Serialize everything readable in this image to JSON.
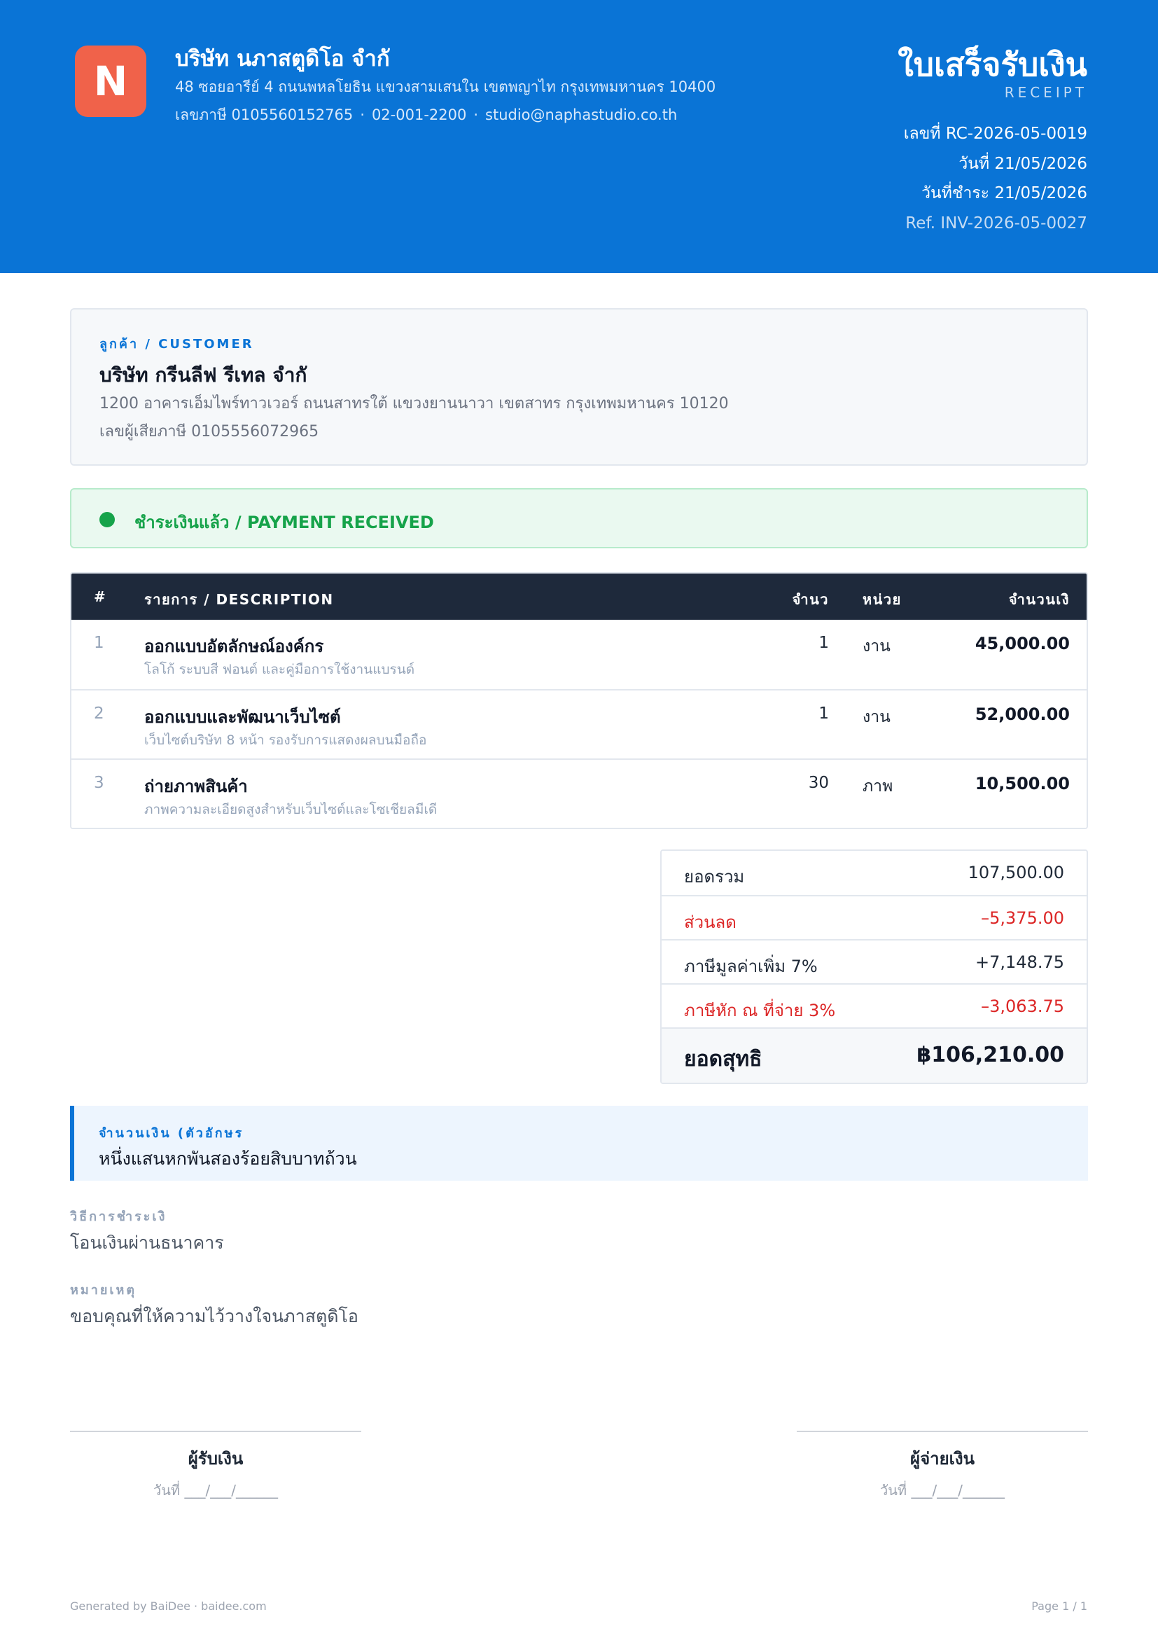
{
  "company": {
    "logo_letter": "N",
    "name": "บริษัท นภาสตูดิโอ จำกั",
    "address": "48 ซอยอารีย์ 4 ถนนพหลโยธิน แขวงสามเสนใน เขตพญาไท กรุงเทพมหานคร 10400",
    "tax_id": "เลขภาษี 0105560152765",
    "phone": "02-001-2200",
    "email": "studio@naphastudio.co.th",
    "separator": "·"
  },
  "document": {
    "title": "ใบเสร็จรับเงิน",
    "subtitle": "RECEIPT",
    "number": "เลขที่ RC-2026-05-0019",
    "date": "วันที่ 21/05/2026",
    "paid_date": "วันที่ชำระ 21/05/2026",
    "reference": "Ref. INV-2026-05-0027"
  },
  "customer": {
    "label": "ลูกค้า / CUSTOMER",
    "name": "บริษัท กรีนลีฟ รีเทล จำกั",
    "address": "1200 อาคารเอ็มไพร์ทาวเวอร์ ถนนสาทรใต้ แขวงยานนาวา เขตสาทร กรุงเทพมหานคร 10120",
    "tax_id": "เลขผู้เสียภาษี 0105556072965"
  },
  "status": {
    "text": "ชำระเงินแล้ว / PAYMENT RECEIVED",
    "color": "#16a34a"
  },
  "items_table": {
    "headers": {
      "num": "#",
      "description": "รายการ / DESCRIPTION",
      "qty": "จำนว",
      "unit": "หน่วย",
      "amount": "จำนวนเงิ"
    },
    "rows": [
      {
        "num": "1",
        "description": "ออกแบบอัตลักษณ์องค์กร",
        "detail": "โลโก้ ระบบสี ฟอนต์ และคู่มือการใช้งานแบรนด์",
        "qty": "1",
        "unit": "งาน",
        "amount": "45,000.00"
      },
      {
        "num": "2",
        "description": "ออกแบบและพัฒนาเว็บไซต์",
        "detail": "เว็บไซต์บริษัท 8 หน้า รองรับการแสดงผลบนมือถือ",
        "qty": "1",
        "unit": "งาน",
        "amount": "52,000.00"
      },
      {
        "num": "3",
        "description": "ถ่ายภาพสินค้า",
        "detail": "ภาพความละเอียดสูงสำหรับเว็บไซต์และโซเชียลมีเดี",
        "qty": "30",
        "unit": "ภาพ",
        "amount": "10,500.00"
      }
    ]
  },
  "totals": {
    "subtotal_label": "ยอดรวม",
    "subtotal": "107,500.00",
    "discount_label": "ส่วนลด",
    "discount": "–5,375.00",
    "vat_label": "ภาษีมูลค่าเพิ่ม 7%",
    "vat": "+7,148.75",
    "wht_label": "ภาษีหัก ณ ที่จ่าย 3%",
    "wht": "–3,063.75",
    "grand_label": "ยอดสุทธิ",
    "grand": "฿106,210.00"
  },
  "amount_words": {
    "label": "จำนวนเงิน (ตัวอักษร",
    "value": "หนึ่งแสนหกพันสองร้อยสิบบาทถ้วน"
  },
  "payment_method": {
    "label": "วิธีการชำระเงิ",
    "value": "โอนเงินผ่านธนาคาร"
  },
  "notes": {
    "label": "หมายเหตุ",
    "value": "ขอบคุณที่ให้ความไว้วางใจนภาสตูดิโอ"
  },
  "signatures": {
    "receiver": "ผู้รับเงิน",
    "payer": "ผู้จ่ายเงิน",
    "date_line": "วันที่ ___/___/______"
  },
  "footer": {
    "generated": "Generated by BaiDee · baidee.com",
    "page": "Page 1 / 1"
  },
  "colors": {
    "brand": "#0a74d6",
    "logo": "#f0624a",
    "table_header": "#1e293b",
    "negative": "#dc2626",
    "paid": "#16a34a"
  }
}
